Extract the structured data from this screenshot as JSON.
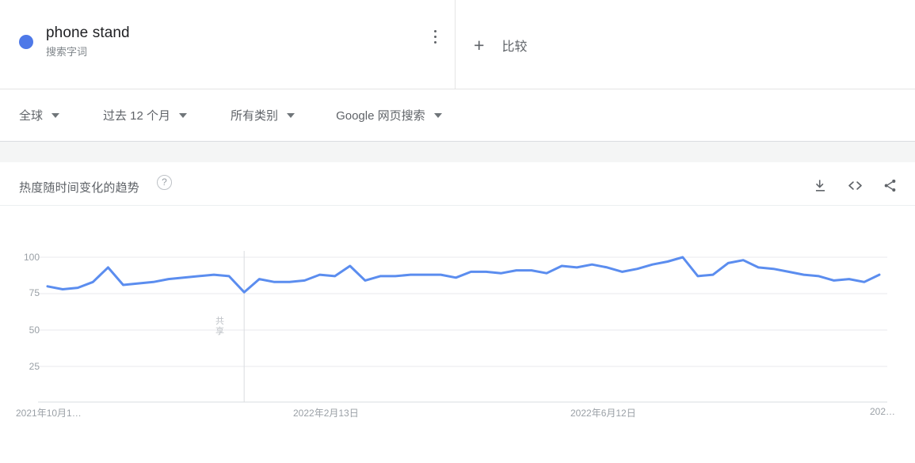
{
  "term": {
    "title": "phone stand",
    "subtitle": "搜索字词",
    "menu_icon": "more-vert-icon",
    "dot_color": "#4e79e8"
  },
  "compare": {
    "plus": "+",
    "label": "比较"
  },
  "filters": [
    {
      "label": "全球",
      "name": "region"
    },
    {
      "label": "过去 12 个月",
      "name": "time-range"
    },
    {
      "label": "所有类别",
      "name": "category"
    },
    {
      "label": "Google 网页搜索",
      "name": "search-type"
    }
  ],
  "chart_panel": {
    "title": "热度随时间变化的趋势",
    "help_glyph": "?",
    "actions": [
      {
        "name": "download-icon"
      },
      {
        "name": "embed-code-icon"
      },
      {
        "name": "share-icon"
      }
    ]
  },
  "chart_data": {
    "type": "line",
    "title": "热度随时间变化的趋势",
    "xlabel": "",
    "ylabel": "",
    "ylim": [
      0,
      105
    ],
    "yticks": [
      100,
      75,
      50,
      25
    ],
    "grid": true,
    "legend": "none",
    "line_color": "#5b8def",
    "xtick_labels": [
      "2021年10月1…",
      "2022年2月13日",
      "2022年6月12日",
      "202…"
    ],
    "marker_label": "共享",
    "series": [
      {
        "name": "phone stand",
        "values": [
          80,
          78,
          79,
          83,
          93,
          81,
          82,
          83,
          85,
          86,
          87,
          88,
          87,
          76,
          85,
          83,
          83,
          84,
          88,
          87,
          94,
          84,
          87,
          87,
          88,
          88,
          88,
          86,
          90,
          90,
          89,
          91,
          91,
          89,
          94,
          93,
          95,
          93,
          90,
          92,
          95,
          97,
          100,
          87,
          88,
          96,
          98,
          93,
          92,
          90,
          88,
          87,
          84,
          85,
          83,
          88
        ]
      }
    ]
  }
}
